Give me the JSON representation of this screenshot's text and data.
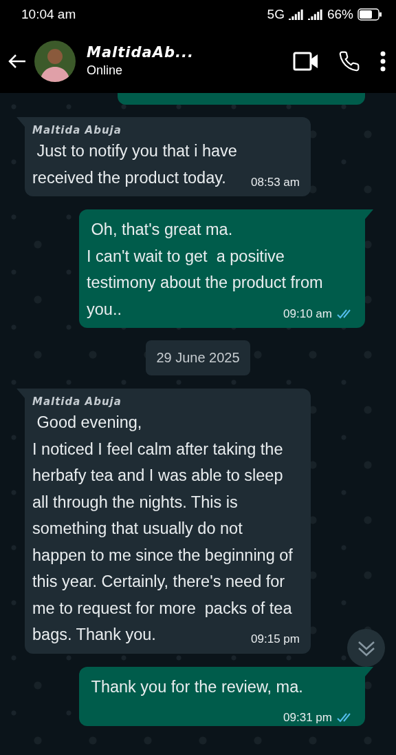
{
  "status_bar": {
    "time": "10:04 am",
    "network": "5G",
    "battery": "66%"
  },
  "header": {
    "name": "MaltidaAb...",
    "status": "Online"
  },
  "messages": [
    {
      "kind": "incoming",
      "sender": "Maltida Abuja",
      "text": " Just to notify you that i have received the product today.",
      "time": "08:53 am"
    },
    {
      "kind": "outgoing",
      "text": " Oh, that's great ma.\nI can't wait to get  a positive testimony about the product from you..",
      "time": "09:10 am",
      "read": true
    },
    {
      "kind": "date",
      "text": "29 June 2025"
    },
    {
      "kind": "incoming",
      "sender": "Maltida Abuja",
      "text": " Good evening,\nI noticed I feel calm after taking the herbafy tea and I was able to sleep all through the nights. This is something that usually do not happen to me since the beginning of this year. Certainly, there's need for me to request for more  packs of tea bags. Thank you.",
      "time": "09:15 pm"
    },
    {
      "kind": "outgoing",
      "text": " Thank you for the review, ma.",
      "time": "09:31 pm",
      "read": true
    }
  ]
}
